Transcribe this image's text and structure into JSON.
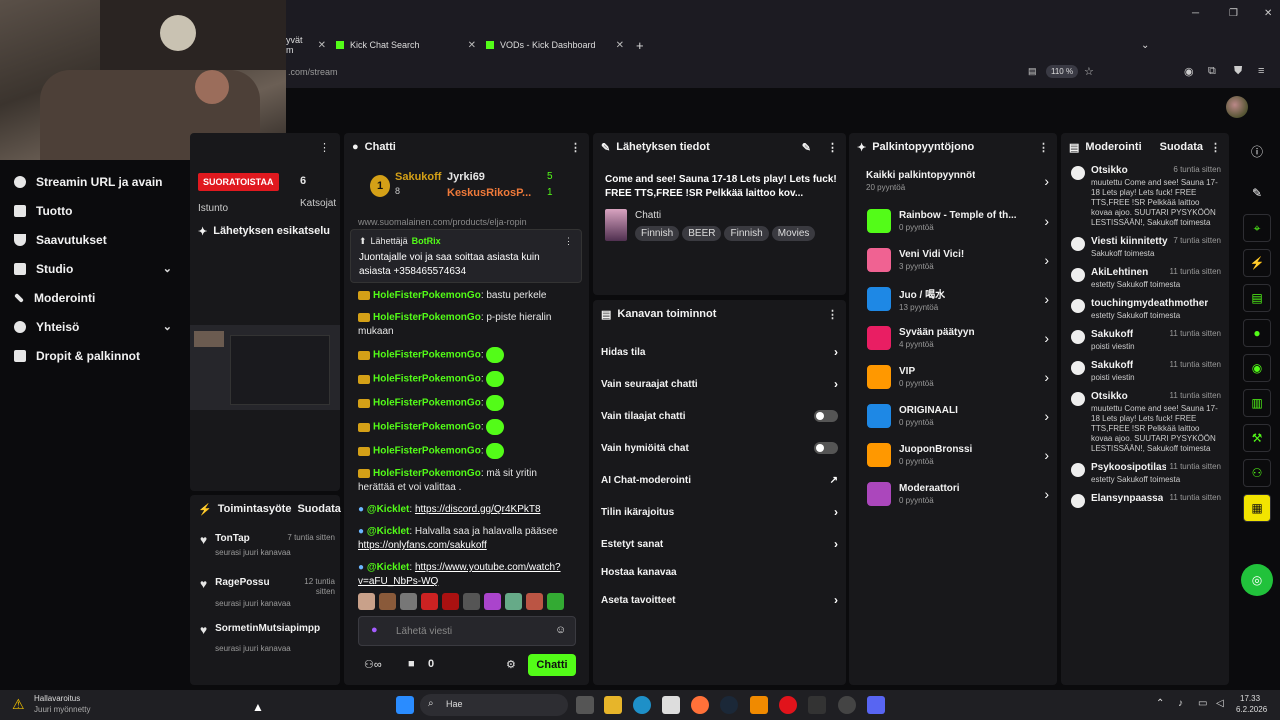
{
  "browser": {
    "tabs": [
      {
        "label": "yvät m"
      },
      {
        "label": "Kick Chat Search"
      },
      {
        "label": "VODs - Kick Dashboard"
      }
    ],
    "url": ".com/stream",
    "zoom": "110 %"
  },
  "sidebar": {
    "items": [
      {
        "label": "Streamin URL ja avain"
      },
      {
        "label": "Tuotto"
      },
      {
        "label": "Saavutukset"
      },
      {
        "label": "Studio"
      },
      {
        "label": "Moderointi"
      },
      {
        "label": "Yhteisö"
      },
      {
        "label": "Dropit & palkinnot"
      }
    ]
  },
  "stream_panel": {
    "live_badge": "SUORATOISTAA",
    "viewers": "6",
    "session_label": "Istunto",
    "viewers_label": "Katsojat",
    "preview_title": "Lähetyksen esikatselu"
  },
  "activity": {
    "title": "Toimintasyöte",
    "filter": "Suodata",
    "items": [
      {
        "name": "TonTap",
        "time": "7 tuntia sitten",
        "desc": "seurasi juuri kanavaa"
      },
      {
        "name": "RagePossu",
        "time": "12 tuntia sitten",
        "desc": "seurasi juuri kanavaa"
      },
      {
        "name": "SormetinMutsiapimpp",
        "time": "",
        "desc": "seurasi juuri kanavaa"
      }
    ]
  },
  "chat": {
    "title": "Chatti",
    "leaders": [
      {
        "name": "Sakukoff",
        "count": "8"
      },
      {
        "name": "Jyrki69",
        "count": "5"
      },
      {
        "name": "KeskusRikosP...",
        "count": "1"
      }
    ],
    "partial_line": "www.suomalainen.com/products/elja-ropin",
    "pinned_by_label": "Lähettäjä",
    "pinned_by": "BotRix",
    "pinned_text": "Juontajalle voi ja saa soittaa asiasta kuin asiasta +358465574634",
    "messages": [
      {
        "user": "HoleFisterPokemonGo",
        "text": ": bastu perkele"
      },
      {
        "user": "HoleFisterPokemonGo",
        "text": ": p-piste hieralin mukaan"
      },
      {
        "user": "HoleFisterPokemonGo",
        "text": ":"
      },
      {
        "user": "HoleFisterPokemonGo",
        "text": ":"
      },
      {
        "user": "HoleFisterPokemonGo",
        "text": ":"
      },
      {
        "user": "HoleFisterPokemonGo",
        "text": ":"
      },
      {
        "user": "HoleFisterPokemonGo",
        "text": ":"
      },
      {
        "user": "HoleFisterPokemonGo",
        "text": ": mä sit yritin herättää et voi valittaa ."
      }
    ],
    "bot_messages": [
      {
        "user": "@Kicklet",
        "text": ": ",
        "link": "https://discord.gg/Qr4KPkT8"
      },
      {
        "user": "@Kicklet",
        "text": ": Halvalla saa ja halavalla pääsee ",
        "link": "https://onlyfans.com/sakukoff"
      },
      {
        "user": "@Kicklet",
        "text": ": ",
        "link": "https://www.youtube.com/watch?v=aFU_NbPs-WQ"
      }
    ],
    "input_placeholder": "Lähetä viesti",
    "points": "0",
    "send_label": "Chatti"
  },
  "stream_info": {
    "title": "Lähetyksen tiedot",
    "stream_title": "Come and see! Sauna 17-18 Lets play! Lets fuck! FREE TTS,FREE !SR Pelkkää laittoo kov...",
    "category": "Chatti",
    "tags": [
      "Finnish",
      "BEER",
      "Finnish",
      "Movies"
    ]
  },
  "channel_actions": {
    "title": "Kanavan toiminnot",
    "items": [
      {
        "label": "Hidas tila",
        "control": "arrow"
      },
      {
        "label": "Vain seuraajat chatti",
        "control": "arrow"
      },
      {
        "label": "Vain tilaajat chatti",
        "control": "toggle"
      },
      {
        "label": "Vain hymiöitä chat",
        "control": "toggle"
      },
      {
        "label": "AI Chat-moderointi",
        "control": "external"
      },
      {
        "label": "Tilin ikärajoitus",
        "control": "arrow"
      },
      {
        "label": "Estetyt sanat",
        "control": "arrow"
      },
      {
        "label": "Hostaa kanavaa",
        "control": "none"
      },
      {
        "label": "Aseta tavoitteet",
        "control": "arrow"
      }
    ]
  },
  "rewards": {
    "title": "Palkintopyyntöjono",
    "all_label": "Kaikki palkintopyynnöt",
    "all_count": "20 pyyntöä",
    "items": [
      {
        "name": "Rainbow - Temple of th...",
        "count": "0 pyyntöä",
        "color": "#53fc18"
      },
      {
        "name": "Veni Vidi Vici!",
        "count": "3 pyyntöä",
        "color": "#f06292"
      },
      {
        "name": "Juo / 喝水",
        "count": "13 pyyntöä",
        "color": "#1e88e5"
      },
      {
        "name": "Syvään päätyyn",
        "count": "4 pyyntöä",
        "color": "#e91e63"
      },
      {
        "name": "VIP",
        "count": "0 pyyntöä",
        "color": "#ff9800"
      },
      {
        "name": "ORIGINAALI",
        "count": "0 pyyntöä",
        "color": "#1e88e5"
      },
      {
        "name": "JuoponBronssi",
        "count": "0 pyyntöä",
        "color": "#ff9800"
      },
      {
        "name": "Moderaattori",
        "count": "0 pyyntöä",
        "color": "#ab47bc"
      }
    ]
  },
  "moderation": {
    "title": "Moderointi",
    "filter": "Suodata",
    "items": [
      {
        "title": "Otsikko",
        "time": "6 tuntia sitten",
        "body": "muutettu Come and see! Sauna 17-18 Lets play! Lets fuck! FREE TTS,FREE !SR Pelkkää laittoo kovaa ajoo. SUUTARI PYSYKÖÖN LESTISSÄÄN!, Sakukoff toimesta"
      },
      {
        "title": "Viesti kiinnitetty",
        "time": "7 tuntia sitten",
        "body": "Sakukoff toimesta"
      },
      {
        "title": "AkiLehtinen",
        "time": "11 tuntia sitten",
        "body": "estetty Sakukoff toimesta"
      },
      {
        "title": "touchingmydeathmother",
        "time": "",
        "body": "estetty Sakukoff toimesta"
      },
      {
        "title": "Sakukoff",
        "time": "11 tuntia sitten",
        "body": "poisti viestin"
      },
      {
        "title": "Sakukoff",
        "time": "11 tuntia sitten",
        "body": "poisti viestin"
      },
      {
        "title": "Otsikko",
        "time": "11 tuntia sitten",
        "body": "muutettu Come and see! Sauna 17-18 Lets play! Lets fuck! FREE TTS,FREE !SR Pelkkää laittoo kovaa ajoo. SUUTARI PYSYKÖÖN LESTISSÄÄN!, Sakukoff toimesta"
      },
      {
        "title": "Psykoosipotilas69",
        "time": "11 tuntia sitten",
        "body": "estetty Sakukoff toimesta"
      },
      {
        "title": "Elansynpaassa",
        "time": "11 tuntia sitten",
        "body": ""
      }
    ]
  },
  "taskbar": {
    "warning_title": "Hallavaroitus",
    "warning_sub": "Juuri myönnetty",
    "search_placeholder": "Hae",
    "time": "17.33",
    "date": "6.2.2026"
  },
  "colors": {
    "accent": "#53fc18",
    "live": "#e0191f",
    "panel": "#18181b"
  }
}
